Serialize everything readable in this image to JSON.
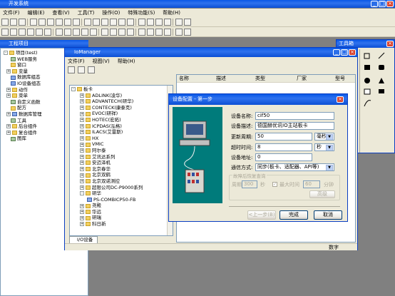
{
  "app": {
    "title": "开发系统",
    "menu": [
      "文件(F)",
      "编辑(E)",
      "查看(V)",
      "工具(T)",
      "操作(O)",
      "特殊功能(S)",
      "帮助(H)"
    ]
  },
  "project_panel": {
    "title": "工程项目",
    "root": "项目(test)",
    "items": [
      "WEB服务",
      "窗口",
      "变量",
      "数据库组态",
      "IO设备组态",
      "动作",
      "菜单",
      "自定义函数",
      "配方",
      "数据库管理",
      "工具",
      "后台组件",
      "复合组件",
      "图库"
    ]
  },
  "toolbox": {
    "title": "工具箱"
  },
  "iomanager": {
    "title": "IoManager",
    "menu": [
      "文件(F)",
      "视图(V)",
      "帮助(H)"
    ],
    "tree_root": "板卡",
    "tree_items": [
      "ADLINK(凌华)",
      "ADVANTECH(研华)",
      "CONTECK(康泰克)",
      "EVOC(研祥)",
      "HOTEC(宏拓)",
      "ICPDAS(泓格)",
      "ILACS(艾雷斯)",
      "HX",
      "VMIC",
      "阿尔泰",
      "艾讯达系列",
      "安迈泽机",
      "北京春华",
      "北京双鹤",
      "北京双诺测控",
      "超限公司DC-P9000系列",
      "研华",
      "PS-COMBICP50-FB",
      "尧殿",
      "华远",
      "研瑞",
      "科日新"
    ],
    "columns": [
      "名称",
      "描述",
      "类型",
      "厂家",
      "型号"
    ],
    "tab": "I/O设备",
    "status": "数字"
  },
  "dialog": {
    "title": "设备配置 - 第一步",
    "labels": {
      "device_name": "设备名称:",
      "device_desc": "设备描述:",
      "update_period": "更新周期:",
      "timeout": "超时时间:",
      "address": "设备地址:",
      "comm_mode": "通信方式:",
      "failover_group": "故障后恢复查询",
      "period": "周期",
      "seconds": "秒",
      "max_time": "最大时间",
      "minutes": "分钟",
      "advanced": "高级"
    },
    "values": {
      "device_name": "cif50",
      "device_desc": "德国赫优讯IO主站板卡",
      "update_period": "50",
      "update_unit": "毫秒",
      "timeout": "8",
      "timeout_unit": "秒",
      "address": "0",
      "comm_mode": "同步(板卡、适配器、API等)",
      "period": "300",
      "max_time": "60"
    },
    "buttons": {
      "back": "<上一步(B)",
      "finish": "完成",
      "cancel": "取消"
    },
    "colors": {
      "art_bg": "#007b7b",
      "title_blue": "#0a58e6"
    }
  }
}
